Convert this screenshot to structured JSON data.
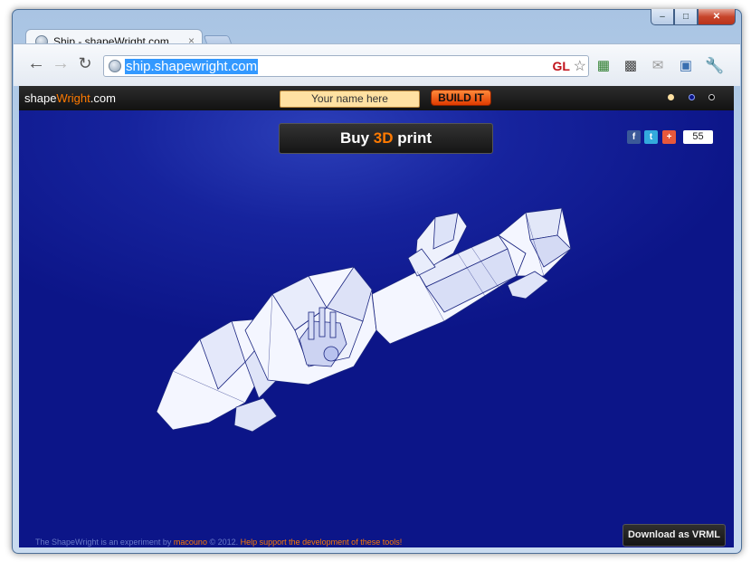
{
  "browser": {
    "tab_title": "Ship - shapeWright.com",
    "tab_close": "×",
    "url": "ship.shapewright.com",
    "gl_badge": "GL",
    "window_min": "–",
    "window_max": "□",
    "window_close": "✕"
  },
  "site": {
    "logo_prefix": "shape",
    "logo_accent": "Wright",
    "logo_suffix": ".com",
    "name_placeholder": "Your name here",
    "build_button": "BUILD IT",
    "buy_prefix": "Buy ",
    "buy_accent": "3D",
    "buy_suffix": " print",
    "share_count": "55",
    "footer_prefix": "The ShapeWright is an experiment by ",
    "footer_author": "macouno",
    "footer_year": " © 2012. ",
    "footer_support": "Help support the development of these tools!",
    "download_button": "Download as VRML"
  },
  "colors": {
    "accent": "#ff7a00",
    "background": "#16239d"
  },
  "icons": {
    "back": "arrow-left-icon",
    "forward": "arrow-right-icon",
    "reload": "reload-icon",
    "star": "star-icon",
    "wrench": "wrench-icon"
  }
}
